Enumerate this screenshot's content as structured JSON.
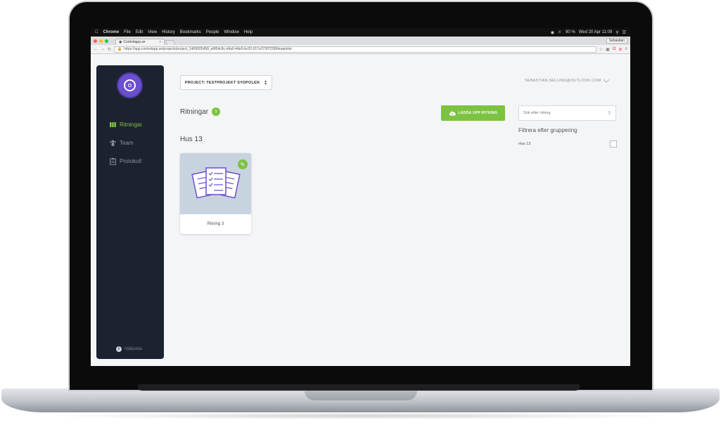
{
  "os_menu": {
    "app_name": "Chrome",
    "items": [
      "File",
      "Edit",
      "View",
      "History",
      "Bookmarks",
      "People",
      "Window",
      "Help"
    ],
    "status_right": "Wed 20 Apr  11:09",
    "battery": "90 %"
  },
  "browser": {
    "tab_title": "Controlapp.se",
    "profile_name": "Sebastian",
    "url": "https://app.controlapp.se/projects/project_1469005458_a6f04c8c-d4a0-4de9-bc02-017e373f7228/blueprints"
  },
  "sidebar": {
    "items": [
      {
        "label": "Ritningar",
        "icon": "blueprint-icon",
        "active": true
      },
      {
        "label": "Team",
        "icon": "team-icon",
        "active": false
      },
      {
        "label": "Protokoll",
        "icon": "clipboard-icon",
        "active": false
      }
    ],
    "help_label": "Hjälpsida"
  },
  "header": {
    "project_select": "PROJECT: TESTPROJEKT SYDPOLEN",
    "user_email": "SEBASTIAN.SELLING@OUTLOOK.COM"
  },
  "main": {
    "title": "Ritningar",
    "count": "1",
    "upload_label": "LADDA UPP RITNING",
    "search_placeholder": "Sök efter ritning",
    "filter_title": "Filtrera efter gruppering",
    "filters": [
      {
        "label": "Hus 13",
        "checked": false
      }
    ],
    "groups": [
      {
        "title": "Hus 13",
        "cards": [
          {
            "label": "Ritning 3"
          }
        ]
      }
    ]
  },
  "colors": {
    "accent_green": "#7cc243",
    "sidebar_bg": "#1d2230",
    "logo_purple": "#6b4fcf"
  }
}
